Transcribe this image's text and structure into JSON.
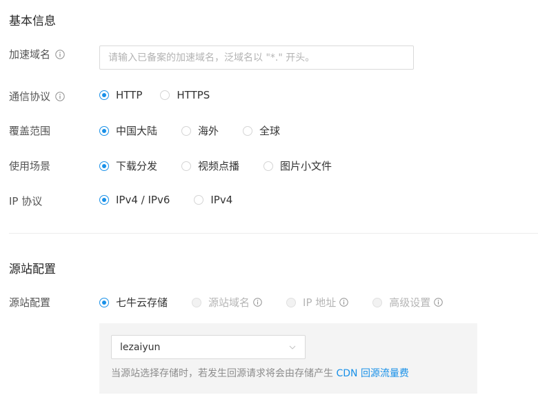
{
  "basic_info": {
    "title": "基本信息",
    "domain": {
      "label": "加速域名",
      "placeholder": "请输入已备案的加速域名，泛域名以 \"*.\" 开头。",
      "value": ""
    },
    "protocol": {
      "label": "通信协议",
      "options": [
        "HTTP",
        "HTTPS"
      ],
      "selected": "HTTP"
    },
    "coverage": {
      "label": "覆盖范围",
      "options": [
        "中国大陆",
        "海外",
        "全球"
      ],
      "selected": "中国大陆"
    },
    "scenario": {
      "label": "使用场景",
      "options": [
        "下载分发",
        "视频点播",
        "图片小文件"
      ],
      "selected": "下载分发"
    },
    "ip_protocol": {
      "label": "IP 协议",
      "options": [
        "IPv4 / IPv6",
        "IPv4"
      ],
      "selected": "IPv4 / IPv6"
    }
  },
  "origin": {
    "title": "源站配置",
    "config": {
      "label": "源站配置",
      "options": [
        "七牛云存储",
        "源站域名",
        "IP 地址",
        "高级设置"
      ],
      "selected": "七牛云存储"
    },
    "bucket": {
      "value": "lezaiyun"
    },
    "hint": {
      "text": "当源站选择存储时，若发生回源请求将会由存储产生 ",
      "link_cdn": "CDN",
      "link_fee": "回源流量费"
    }
  },
  "colors": {
    "accent": "#1890e8",
    "panel_bg": "#f4f4f4",
    "label": "#555555"
  }
}
